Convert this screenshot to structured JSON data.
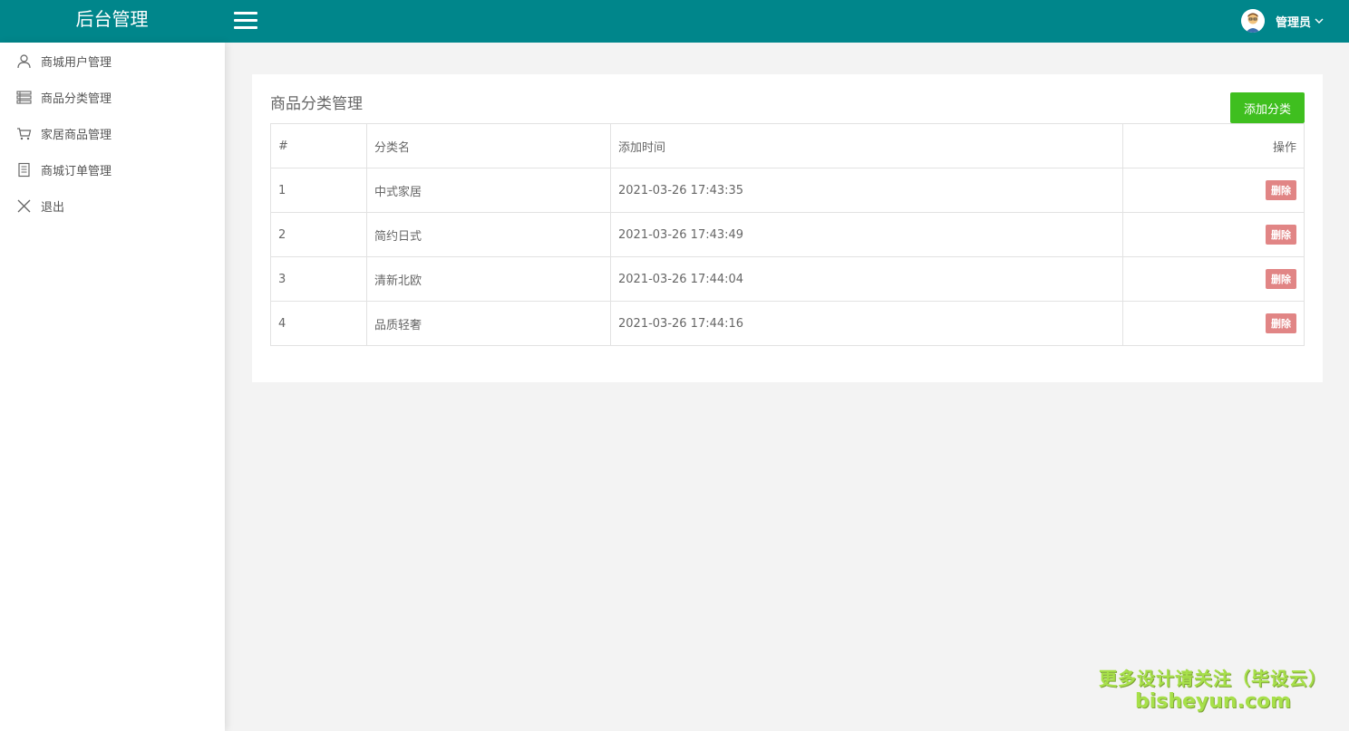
{
  "header": {
    "brand": "后台管理",
    "user_name": "管理员",
    "accent": "#00868b"
  },
  "sidebar": {
    "items": [
      {
        "label": "商城用户管理",
        "icon": "user-icon"
      },
      {
        "label": "商品分类管理",
        "icon": "list-icon"
      },
      {
        "label": "家居商品管理",
        "icon": "cart-icon"
      },
      {
        "label": "商城订单管理",
        "icon": "receipt-icon"
      },
      {
        "label": "退出",
        "icon": "close-icon"
      }
    ]
  },
  "main": {
    "title": "商品分类管理",
    "add_button": "添加分类",
    "add_button_color": "#3fbf1f",
    "table": {
      "columns": [
        "#",
        "分类名",
        "添加时间",
        "操作"
      ],
      "rows": [
        {
          "num": "1",
          "name": "中式家居",
          "time": "2021-03-26 17:43:35",
          "action": "删除"
        },
        {
          "num": "2",
          "name": "简约日式",
          "time": "2021-03-26 17:43:49",
          "action": "删除"
        },
        {
          "num": "3",
          "name": "清新北欧",
          "time": "2021-03-26 17:44:04",
          "action": "删除"
        },
        {
          "num": "4",
          "name": "品质轻奢",
          "time": "2021-03-26 17:44:16",
          "action": "删除"
        }
      ]
    }
  },
  "watermark": {
    "line1": "更多设计请关注（毕设云）",
    "line2": "bisheyun.com"
  }
}
